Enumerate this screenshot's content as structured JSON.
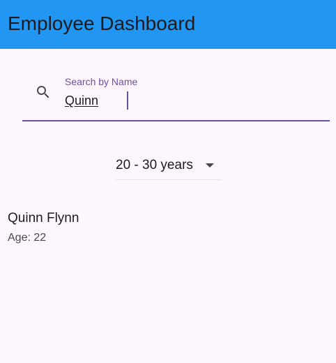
{
  "app_bar": {
    "title": "Employee Dashboard",
    "background_color": "#2196f3"
  },
  "search": {
    "icon": "search-icon",
    "label": "Search by Name",
    "value": "Quinn",
    "accent_color": "#6750a4"
  },
  "age_filter": {
    "selected": "20 - 30 years",
    "icon": "arrow-drop-down-icon"
  },
  "employees": [
    {
      "name": "Quinn Flynn",
      "age_text": "Age: 22"
    }
  ]
}
